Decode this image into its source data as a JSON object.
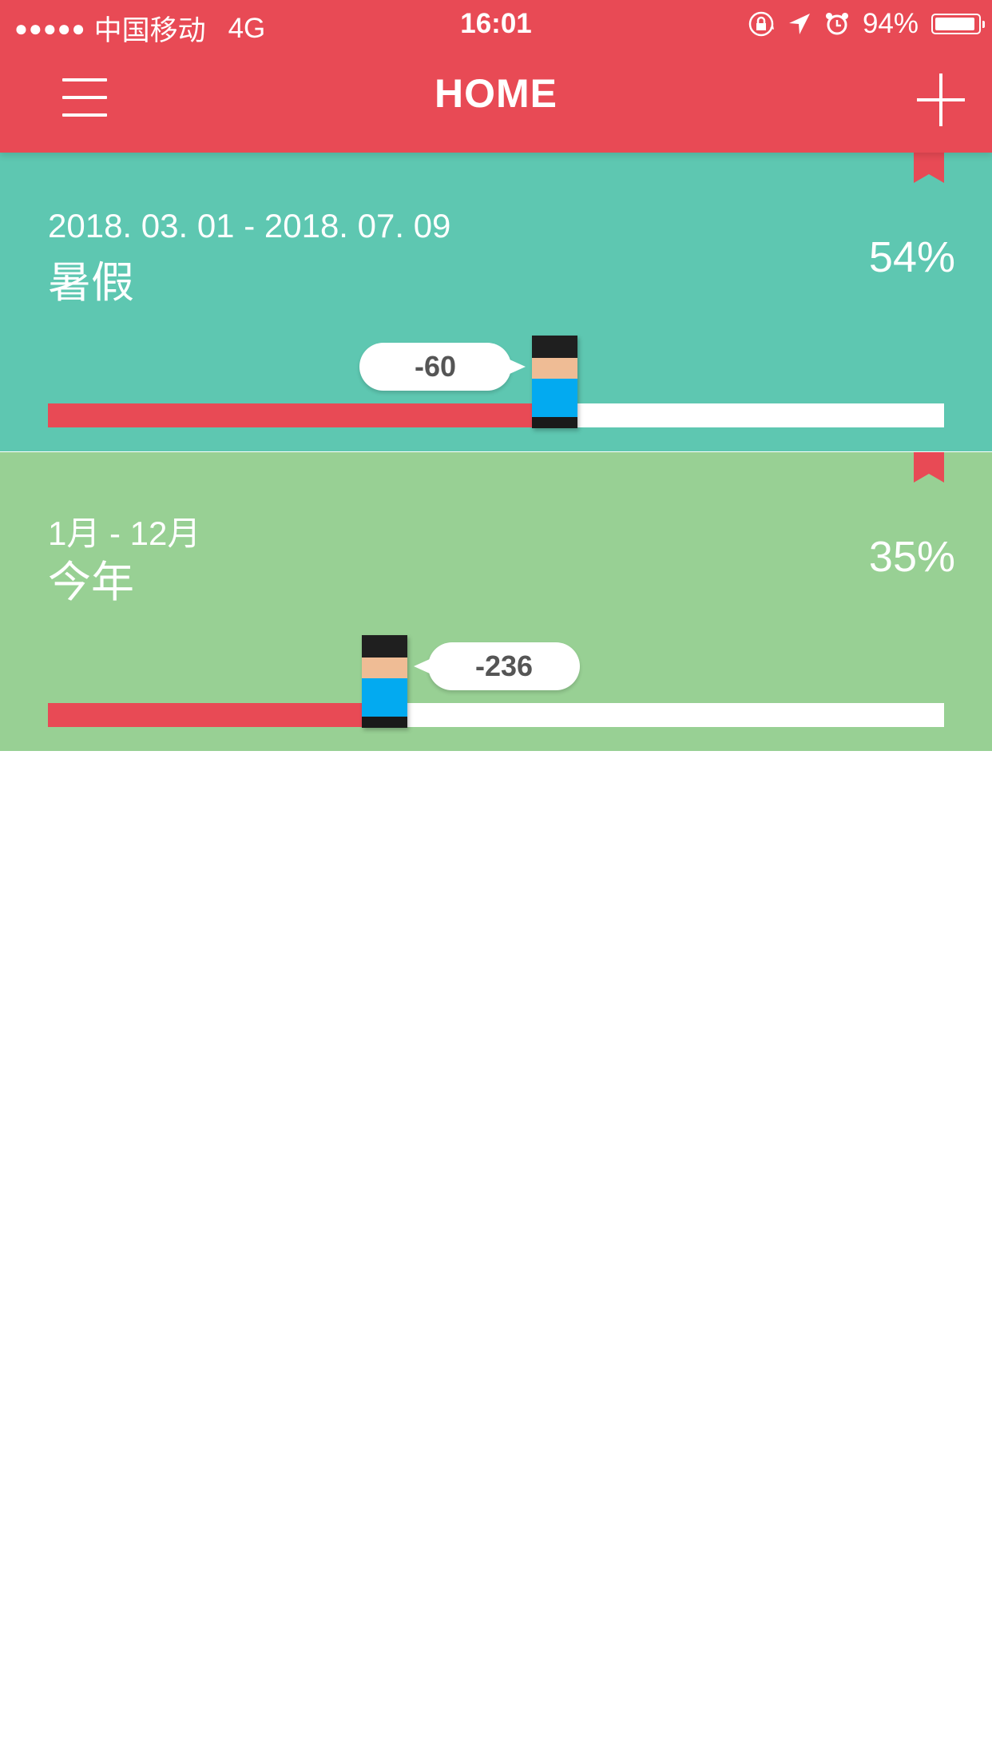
{
  "status_bar": {
    "signal_dots": "●●●●●",
    "carrier": "中国移动",
    "network": "4G",
    "time": "16:01",
    "battery_percent": "94%",
    "battery_level": 0.94
  },
  "header": {
    "title": "HOME",
    "menu_icon": "hamburger-menu-icon",
    "add_icon": "plus-icon",
    "background": "#e84a55"
  },
  "cards": [
    {
      "date_range": "2018. 03. 01 - 2018. 07. 09",
      "title": "暑假",
      "percent": "54%",
      "progress": 0.54,
      "days_remaining": "-60",
      "background": "#5ec7b1",
      "bookmark_color": "#e84a55"
    },
    {
      "date_range": "1月 - 12月",
      "title": "今年",
      "percent": "35%",
      "progress": 0.35,
      "days_remaining": "-236",
      "background": "#98d094",
      "bookmark_color": "#e84a55"
    }
  ],
  "colors": {
    "accent": "#e84a55",
    "track": "#ffffff",
    "avatar_hair": "#1f1f1f",
    "avatar_face": "#efbc95",
    "avatar_shirt": "#03aaf0"
  }
}
